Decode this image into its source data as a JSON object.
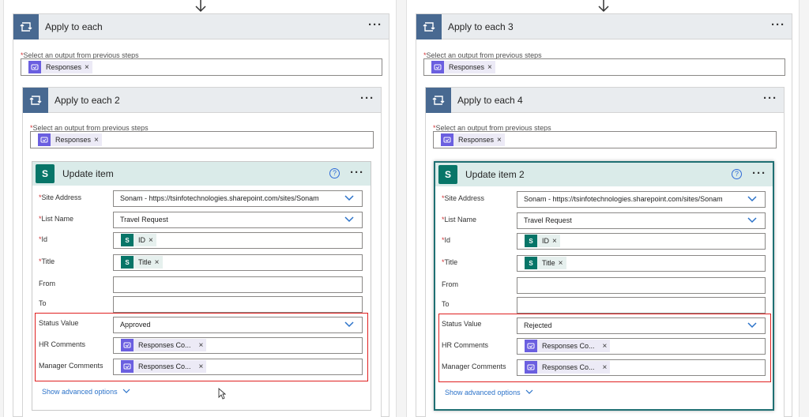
{
  "left": {
    "outer_loop": {
      "title": "Apply to each",
      "select_label": "Select an output from previous steps",
      "token": "Responses"
    },
    "inner_loop": {
      "title": "Apply to each 2",
      "select_label": "Select an output from previous steps",
      "token": "Responses"
    },
    "action": {
      "title": "Update item",
      "fields": {
        "site_address": {
          "label": "Site Address",
          "value": "Sonam - https://tsinfotechnologies.sharepoint.com/sites/Sonam"
        },
        "list_name": {
          "label": "List Name",
          "value": "Travel Request"
        },
        "id": {
          "label": "Id",
          "token": "ID"
        },
        "title": {
          "label": "Title",
          "token": "Title"
        },
        "from": {
          "label": "From"
        },
        "to": {
          "label": "To"
        },
        "status_value": {
          "label": "Status Value",
          "value": "Approved"
        },
        "hr_comments": {
          "label": "HR Comments",
          "token": "Responses Co..."
        },
        "manager_comments": {
          "label": "Manager Comments",
          "token": "Responses Co..."
        }
      },
      "advanced": "Show advanced options"
    }
  },
  "right": {
    "outer_loop": {
      "title": "Apply to each 3",
      "select_label": "Select an output from previous steps",
      "token": "Responses"
    },
    "inner_loop": {
      "title": "Apply to each 4",
      "select_label": "Select an output from previous steps",
      "token": "Responses"
    },
    "action": {
      "title": "Update item 2",
      "fields": {
        "site_address": {
          "label": "Site Address",
          "value": "Sonam - https://tsinfotechnologies.sharepoint.com/sites/Sonam"
        },
        "list_name": {
          "label": "List Name",
          "value": "Travel Request"
        },
        "id": {
          "label": "Id",
          "token": "ID"
        },
        "title": {
          "label": "Title",
          "token": "Title"
        },
        "from": {
          "label": "From"
        },
        "to": {
          "label": "To"
        },
        "status_value": {
          "label": "Status Value",
          "value": "Rejected"
        },
        "hr_comments": {
          "label": "HR Comments",
          "token": "Responses Co..."
        },
        "manager_comments": {
          "label": "Manager Comments",
          "token": "Responses Co..."
        }
      },
      "advanced": "Show advanced options"
    }
  },
  "common": {
    "more": "···",
    "help": "?",
    "required": "*",
    "remove": "×",
    "sp_letter": "S"
  },
  "colors": {
    "loop_icon_bg": "#486991",
    "forms_token_bg": "#6b5fe0",
    "sharepoint_bg": "#077568",
    "highlight_border": "#e02020",
    "link": "#2b72c9"
  }
}
